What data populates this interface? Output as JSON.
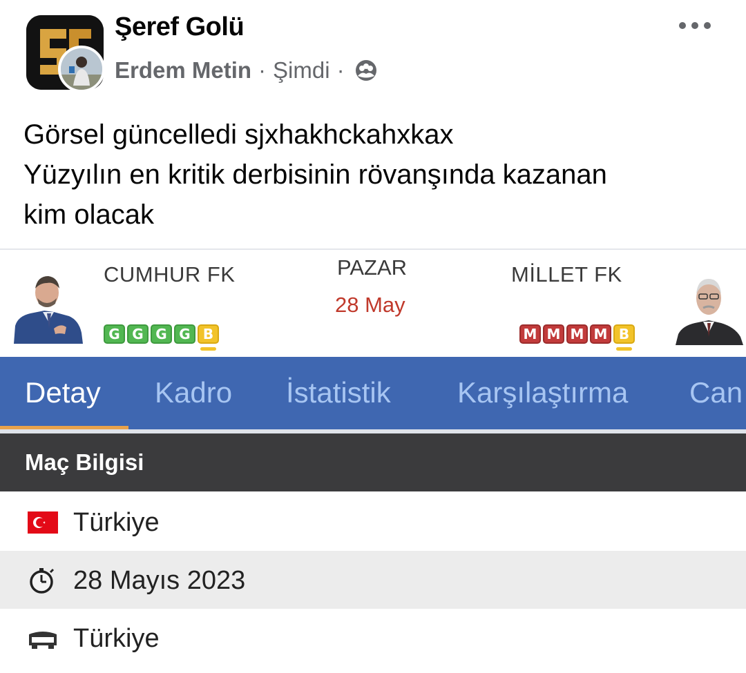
{
  "post": {
    "group_name": "Şeref Golü",
    "author": "Erdem Metin",
    "separator": "·",
    "time": "Şimdi",
    "lines": [
      "Görsel güncelledi sjxhakhckahxkax",
      "Yüzyılın en kritik derbisinin rövanşında kazanan",
      "kim olacak"
    ],
    "icons": {
      "group_logo": "sg-logo-icon",
      "avatar": "user-avatar-icon",
      "privacy": "group-members-icon",
      "more": "more-options-icon"
    }
  },
  "match": {
    "home_team": "CUMHUR FK",
    "away_team": "MİLLET FK",
    "day": "PAZAR",
    "date": "28 May",
    "home_form": [
      "G",
      "G",
      "G",
      "G",
      "B"
    ],
    "away_form": [
      "M",
      "M",
      "M",
      "M",
      "B"
    ],
    "colors": {
      "win": "#52b752",
      "loss": "#c23b3b",
      "draw": "#f2c32a",
      "tab_bar": "#3f67b1",
      "tab_active_indicator": "#e8a24b",
      "date": "#c0392b"
    },
    "tabs": [
      "Detay",
      "Kadro",
      "İstatistik",
      "Karşılaştırma",
      "Can"
    ],
    "active_tab": "Detay",
    "section_title": "Maç Bilgisi",
    "info_rows": [
      {
        "icon": "turkey-flag-icon",
        "text": "Türkiye"
      },
      {
        "icon": "stopwatch-icon",
        "text": "28 Mayıs 2023"
      },
      {
        "icon": "stadium-icon",
        "text": "Türkiye"
      }
    ]
  }
}
